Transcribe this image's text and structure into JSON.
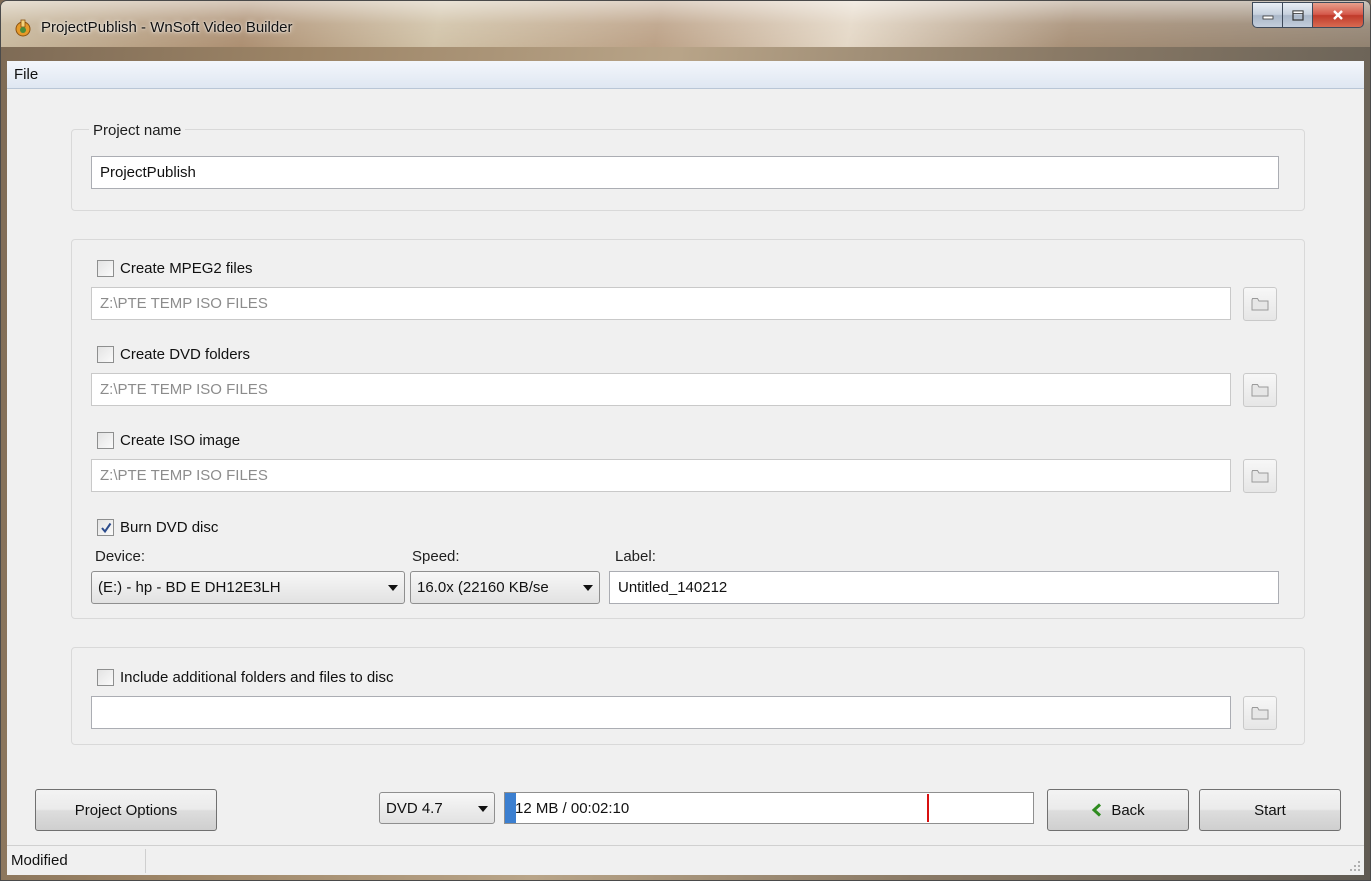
{
  "window": {
    "title": "ProjectPublish - WnSoft Video Builder"
  },
  "menu": {
    "file": "File"
  },
  "project": {
    "name_label": "Project name",
    "name_value": "ProjectPublish"
  },
  "outputs": {
    "mpeg2": {
      "label": "Create MPEG2 files",
      "checked": false,
      "path": "Z:\\PTE TEMP ISO FILES"
    },
    "dvd_folders": {
      "label": "Create DVD folders",
      "checked": false,
      "path": "Z:\\PTE TEMP ISO FILES"
    },
    "iso": {
      "label": "Create ISO image",
      "checked": false,
      "path": "Z:\\PTE TEMP ISO FILES"
    },
    "burn": {
      "label": "Burn DVD disc",
      "checked": true,
      "device_label": "Device:",
      "device_value": "(E:) - hp - BD  E  DH12E3LH",
      "speed_label": "Speed:",
      "speed_value": "16.0x (22160 KB/se",
      "disc_label_label": "Label:",
      "disc_label_value": "Untitled_140212"
    }
  },
  "extra": {
    "label": "Include additional folders and files to disc",
    "checked": false,
    "path": ""
  },
  "footer": {
    "project_options": "Project Options",
    "disc_type": "DVD 4.7",
    "size_text": "12 MB / 00:02:10",
    "size_fill_fraction": 0.02,
    "size_limit_fraction": 0.8,
    "back": "Back",
    "start": "Start"
  },
  "status": {
    "text": "Modified"
  },
  "icons": {
    "app": "app-icon",
    "folder": "folder-icon",
    "back_arrow": "back-arrow-icon",
    "dropdown": "chevron-down-icon"
  },
  "colors": {
    "accent": "#3b7fd0",
    "limit_marker": "#d81010",
    "back_arrow": "#2e8b1f"
  }
}
